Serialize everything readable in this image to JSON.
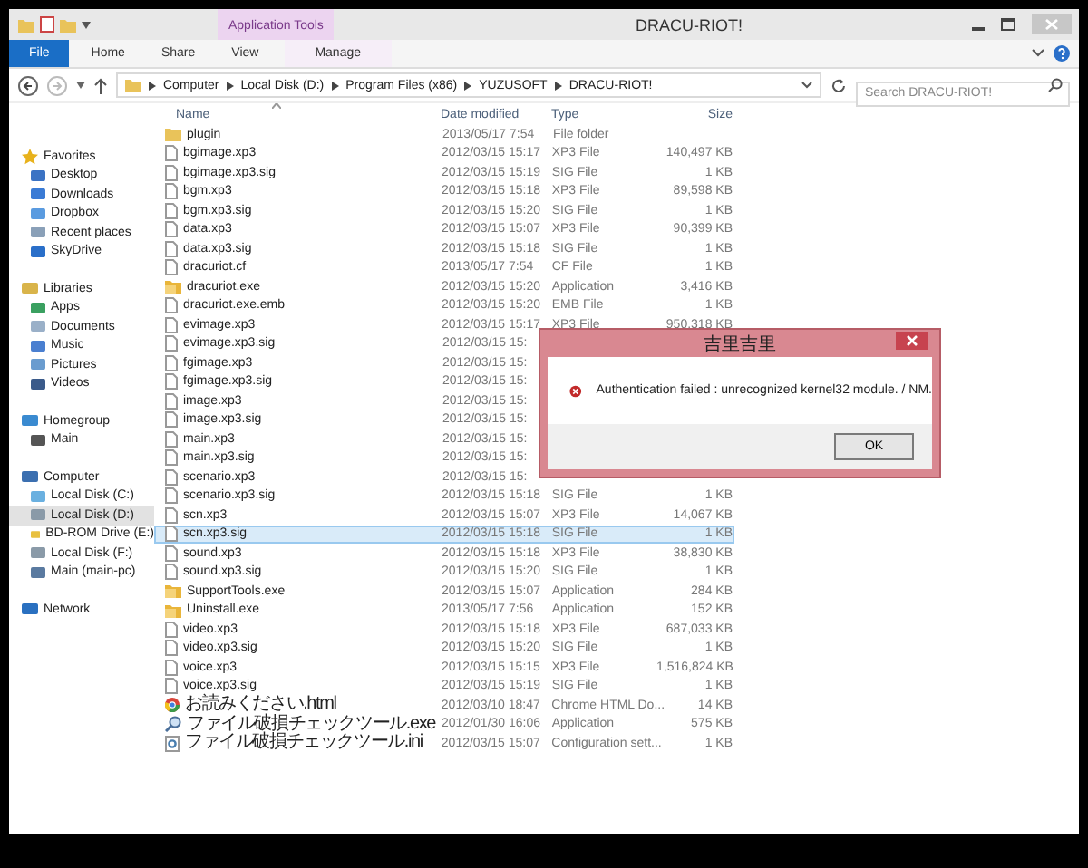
{
  "window": {
    "title": "DRACU-RIOT!",
    "context_group": "Application Tools"
  },
  "ribbon_tabs": [
    {
      "label": "File",
      "kind": "file"
    },
    {
      "label": "Home",
      "kind": "tab"
    },
    {
      "label": "Share",
      "kind": "tab"
    },
    {
      "label": "View",
      "kind": "tab"
    },
    {
      "label": "Manage",
      "kind": "context"
    }
  ],
  "address": {
    "crumbs": [
      "Computer",
      "Local Disk (D:)",
      "Program Files (x86)",
      "YUZUSOFT",
      "DRACU-RIOT!"
    ],
    "search": {
      "placeholder": "Search DRACU-RIOT!"
    }
  },
  "sidebar": {
    "groups": [
      {
        "label": "Favorites",
        "kind": "star",
        "children": [
          {
            "label": "Desktop",
            "kind": "desktop",
            "selected": false
          },
          {
            "label": "Downloads",
            "kind": "download",
            "selected": false
          },
          {
            "label": "Dropbox",
            "kind": "box",
            "selected": false
          },
          {
            "label": "Recent places",
            "kind": "recent",
            "selected": false
          },
          {
            "label": "SkyDrive",
            "kind": "cloud",
            "selected": false
          }
        ]
      },
      {
        "label": "Libraries",
        "kind": "library",
        "children": [
          {
            "label": "Apps",
            "kind": "apps",
            "selected": false
          },
          {
            "label": "Documents",
            "kind": "doc",
            "selected": false
          },
          {
            "label": "Music",
            "kind": "music",
            "selected": false
          },
          {
            "label": "Pictures",
            "kind": "pictures",
            "selected": false
          },
          {
            "label": "Videos",
            "kind": "video",
            "selected": false
          }
        ]
      },
      {
        "label": "Homegroup",
        "kind": "homegroup",
        "children": [
          {
            "label": "Main",
            "kind": "user",
            "selected": false
          }
        ]
      },
      {
        "label": "Computer",
        "kind": "computer",
        "children": [
          {
            "label": "Local Disk (C:)",
            "kind": "sysdrive",
            "selected": false
          },
          {
            "label": "Local Disk (D:)",
            "kind": "drive",
            "selected": true
          },
          {
            "label": "BD-ROM Drive (E:)",
            "kind": "disc",
            "selected": false
          },
          {
            "label": "Local Disk (F:)",
            "kind": "drive",
            "selected": false
          },
          {
            "label": "Main (main-pc)",
            "kind": "pc",
            "selected": false
          }
        ]
      },
      {
        "label": "Network",
        "kind": "network"
      }
    ]
  },
  "columns": [
    "Name",
    "Date modified",
    "Type",
    "Size"
  ],
  "files": [
    {
      "name": "plugin",
      "date": "2013/05/17 7:54",
      "type": "File folder",
      "kind": "folder",
      "selected": false
    },
    {
      "name": "bgimage.xp3",
      "date": "2012/03/15 15:17",
      "type": "XP3 File",
      "size": "140,497 KB",
      "kind": "file",
      "selected": false
    },
    {
      "name": "bgimage.xp3.sig",
      "date": "2012/03/15 15:19",
      "type": "SIG File",
      "size": "1 KB",
      "kind": "file",
      "selected": false
    },
    {
      "name": "bgm.xp3",
      "date": "2012/03/15 15:18",
      "type": "XP3 File",
      "size": "89,598 KB",
      "kind": "file",
      "selected": false
    },
    {
      "name": "bgm.xp3.sig",
      "date": "2012/03/15 15:20",
      "type": "SIG File",
      "size": "1 KB",
      "kind": "file",
      "selected": false
    },
    {
      "name": "data.xp3",
      "date": "2012/03/15 15:07",
      "type": "XP3 File",
      "size": "90,399 KB",
      "kind": "file",
      "selected": false
    },
    {
      "name": "data.xp3.sig",
      "date": "2012/03/15 15:18",
      "type": "SIG File",
      "size": "1 KB",
      "kind": "file",
      "selected": false
    },
    {
      "name": "dracuriot.cf",
      "date": "2013/05/17 7:54",
      "type": "CF File",
      "size": "1 KB",
      "kind": "file",
      "selected": false
    },
    {
      "name": "dracuriot.exe",
      "date": "2012/03/15 15:20",
      "type": "Application",
      "size": "3,416 KB",
      "kind": "app",
      "selected": false
    },
    {
      "name": "dracuriot.exe.emb",
      "date": "2012/03/15 15:20",
      "type": "EMB File",
      "size": "1 KB",
      "kind": "file",
      "selected": false
    },
    {
      "name": "evimage.xp3",
      "date": "2012/03/15 15:17",
      "type": "XP3 File",
      "size": "950,318 KB",
      "kind": "file",
      "selected": false
    },
    {
      "name": "evimage.xp3.sig",
      "date": "2012/03/15 15:",
      "kind": "file",
      "selected": false
    },
    {
      "name": "fgimage.xp3",
      "date": "2012/03/15 15:",
      "kind": "file",
      "selected": false
    },
    {
      "name": "fgimage.xp3.sig",
      "date": "2012/03/15 15:",
      "kind": "file",
      "selected": false
    },
    {
      "name": "image.xp3",
      "date": "2012/03/15 15:",
      "kind": "file",
      "selected": false
    },
    {
      "name": "image.xp3.sig",
      "date": "2012/03/15 15:",
      "kind": "file",
      "selected": false
    },
    {
      "name": "main.xp3",
      "date": "2012/03/15 15:",
      "kind": "file",
      "selected": false
    },
    {
      "name": "main.xp3.sig",
      "date": "2012/03/15 15:",
      "kind": "file",
      "selected": false
    },
    {
      "name": "scenario.xp3",
      "date": "2012/03/15 15:",
      "kind": "file",
      "selected": false
    },
    {
      "name": "scenario.xp3.sig",
      "date": "2012/03/15 15:18",
      "type": "SIG File",
      "size": "1 KB",
      "kind": "file",
      "selected": false
    },
    {
      "name": "scn.xp3",
      "date": "2012/03/15 15:07",
      "type": "XP3 File",
      "size": "14,067 KB",
      "kind": "file",
      "selected": false
    },
    {
      "name": "scn.xp3.sig",
      "date": "2012/03/15 15:18",
      "type": "SIG File",
      "size": "1 KB",
      "kind": "file",
      "selected": true
    },
    {
      "name": "sound.xp3",
      "date": "2012/03/15 15:18",
      "type": "XP3 File",
      "size": "38,830 KB",
      "kind": "file",
      "selected": false
    },
    {
      "name": "sound.xp3.sig",
      "date": "2012/03/15 15:20",
      "type": "SIG File",
      "size": "1 KB",
      "kind": "file",
      "selected": false
    },
    {
      "name": "SupportTools.exe",
      "date": "2012/03/15 15:07",
      "type": "Application",
      "size": "284 KB",
      "kind": "app",
      "selected": false
    },
    {
      "name": "Uninstall.exe",
      "date": "2013/05/17 7:56",
      "type": "Application",
      "size": "152 KB",
      "kind": "app",
      "selected": false
    },
    {
      "name": "video.xp3",
      "date": "2012/03/15 15:18",
      "type": "XP3 File",
      "size": "687,033 KB",
      "kind": "file",
      "selected": false
    },
    {
      "name": "video.xp3.sig",
      "date": "2012/03/15 15:20",
      "type": "SIG File",
      "size": "1 KB",
      "kind": "file",
      "selected": false
    },
    {
      "name": "voice.xp3",
      "date": "2012/03/15 15:15",
      "type": "XP3 File",
      "size": "1,516,824 KB",
      "kind": "file",
      "selected": false
    },
    {
      "name": "voice.xp3.sig",
      "date": "2012/03/15 15:19",
      "type": "SIG File",
      "size": "1 KB",
      "kind": "file",
      "selected": false
    },
    {
      "name": "お読みください.html",
      "date": "2012/03/10 18:47",
      "type": "Chrome HTML Do...",
      "size": "14 KB",
      "kind": "web",
      "selected": false
    },
    {
      "name": "ファイル破損チェックツール.exe",
      "date": "2012/01/30 16:06",
      "type": "Application",
      "size": "575 KB",
      "kind": "tool",
      "selected": false
    },
    {
      "name": "ファイル破損チェックツール.ini",
      "date": "2012/03/15 15:07",
      "type": "Configuration sett...",
      "size": "1 KB",
      "kind": "settings",
      "selected": false
    }
  ],
  "dialog": {
    "title": "吉里吉里",
    "message": "Authentication failed : unrecognized kernel32 module. / NM.",
    "button": "OK"
  }
}
